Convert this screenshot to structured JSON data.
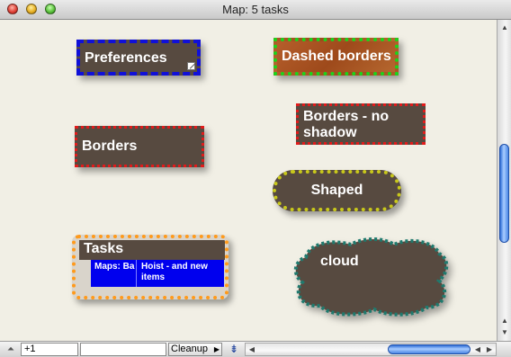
{
  "window": {
    "title": "Map: 5 tasks",
    "controls": [
      "close-icon",
      "minimize-icon",
      "zoom-icon"
    ]
  },
  "canvas": {
    "nodes": [
      {
        "id": "preferences",
        "label": "Preferences",
        "border_style": "dashed",
        "border_color": "#1010d8",
        "fill": "#574a40"
      },
      {
        "id": "dashed-borders",
        "label": "Dashed borders",
        "border_style": "dotted",
        "border_color": "#1bd41b",
        "fill": "#a8531f"
      },
      {
        "id": "borders",
        "label": "Borders",
        "border_style": "dotted",
        "border_color": "#e11b1b",
        "fill": "#574a40"
      },
      {
        "id": "borders-no-shadow",
        "label": "Borders - no shadow",
        "border_style": "dotted",
        "border_color": "#e11b1b",
        "fill": "#574a40"
      },
      {
        "id": "shaped",
        "label": "Shaped",
        "border_style": "dotted",
        "border_color": "#c8c81b",
        "fill": "#574a40"
      },
      {
        "id": "tasks",
        "label": "Tasks",
        "border_style": "dotted",
        "border_color": "#ff9a1b",
        "fill": "#d9d4cb",
        "children": [
          {
            "label": "Maps: Ba longer sc",
            "fill": "#0000ee"
          },
          {
            "label": "Hoist - and new items",
            "fill": "#0000ee"
          }
        ]
      },
      {
        "id": "cloud",
        "label": "cloud",
        "border_style": "dotted",
        "border_color": "#1f7a6e",
        "fill": "#574a40"
      }
    ]
  },
  "toolbar": {
    "level_up_icon": "arrow-up-icon",
    "level_value": "+1",
    "search_value": "",
    "cleanup_label": "Cleanup",
    "insert_icon": "insert-icon"
  }
}
